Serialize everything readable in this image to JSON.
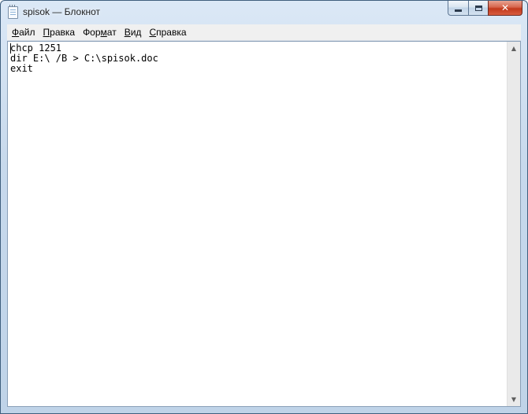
{
  "window": {
    "title": "spisok — Блокнот",
    "minimize_icon": "minimize-icon",
    "maximize_icon": "maximize-icon",
    "close_icon": "close-icon",
    "close_glyph": "✕"
  },
  "menu": {
    "items": [
      {
        "accel": "Ф",
        "rest": "айл"
      },
      {
        "accel": "П",
        "rest": "равка"
      },
      {
        "accel": "",
        "pre": "Фор",
        "mid": "м",
        "rest": "ат"
      },
      {
        "accel": "В",
        "rest": "ид"
      },
      {
        "accel": "С",
        "rest": "правка"
      }
    ]
  },
  "editor": {
    "content": "chcp 1251\ndir E:\\ /B > C:\\spisok.doc\nexit"
  },
  "scrollbar": {
    "up_arrow": "▲",
    "down_arrow": "▼"
  },
  "colors": {
    "title_bar": "#c7d9ec",
    "close_button": "#c2391c",
    "menu_bar": "#f0f0f0"
  }
}
